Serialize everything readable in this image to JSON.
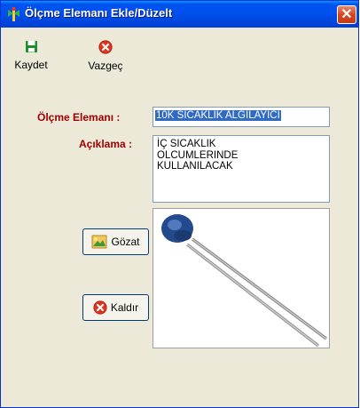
{
  "window": {
    "title": "Ölçme Elemanı Ekle/Düzelt"
  },
  "toolbar": {
    "save_label": "Kaydet",
    "cancel_label": "Vazgeç"
  },
  "form": {
    "element_label": "Ölçme Elemanı :",
    "element_value": "10K SICAKLIK ALGILAYICI",
    "description_label": "Açıklama :",
    "description_lines": [
      "İÇ SICAKLIK",
      "OLCUMLERINDE",
      "KULLANILACAK"
    ]
  },
  "buttons": {
    "browse_label": "Gözat",
    "remove_label": "Kaldır"
  },
  "icons": {
    "title": "app-icon",
    "save": "floppy-disk-icon",
    "cancel": "red-x-icon",
    "browse": "picture-folder-icon",
    "remove": "red-x-icon"
  },
  "colors": {
    "titlebar": "#0050EE",
    "label": "#A00000",
    "selection": "#316AC5",
    "window": "#ECE9D8"
  }
}
